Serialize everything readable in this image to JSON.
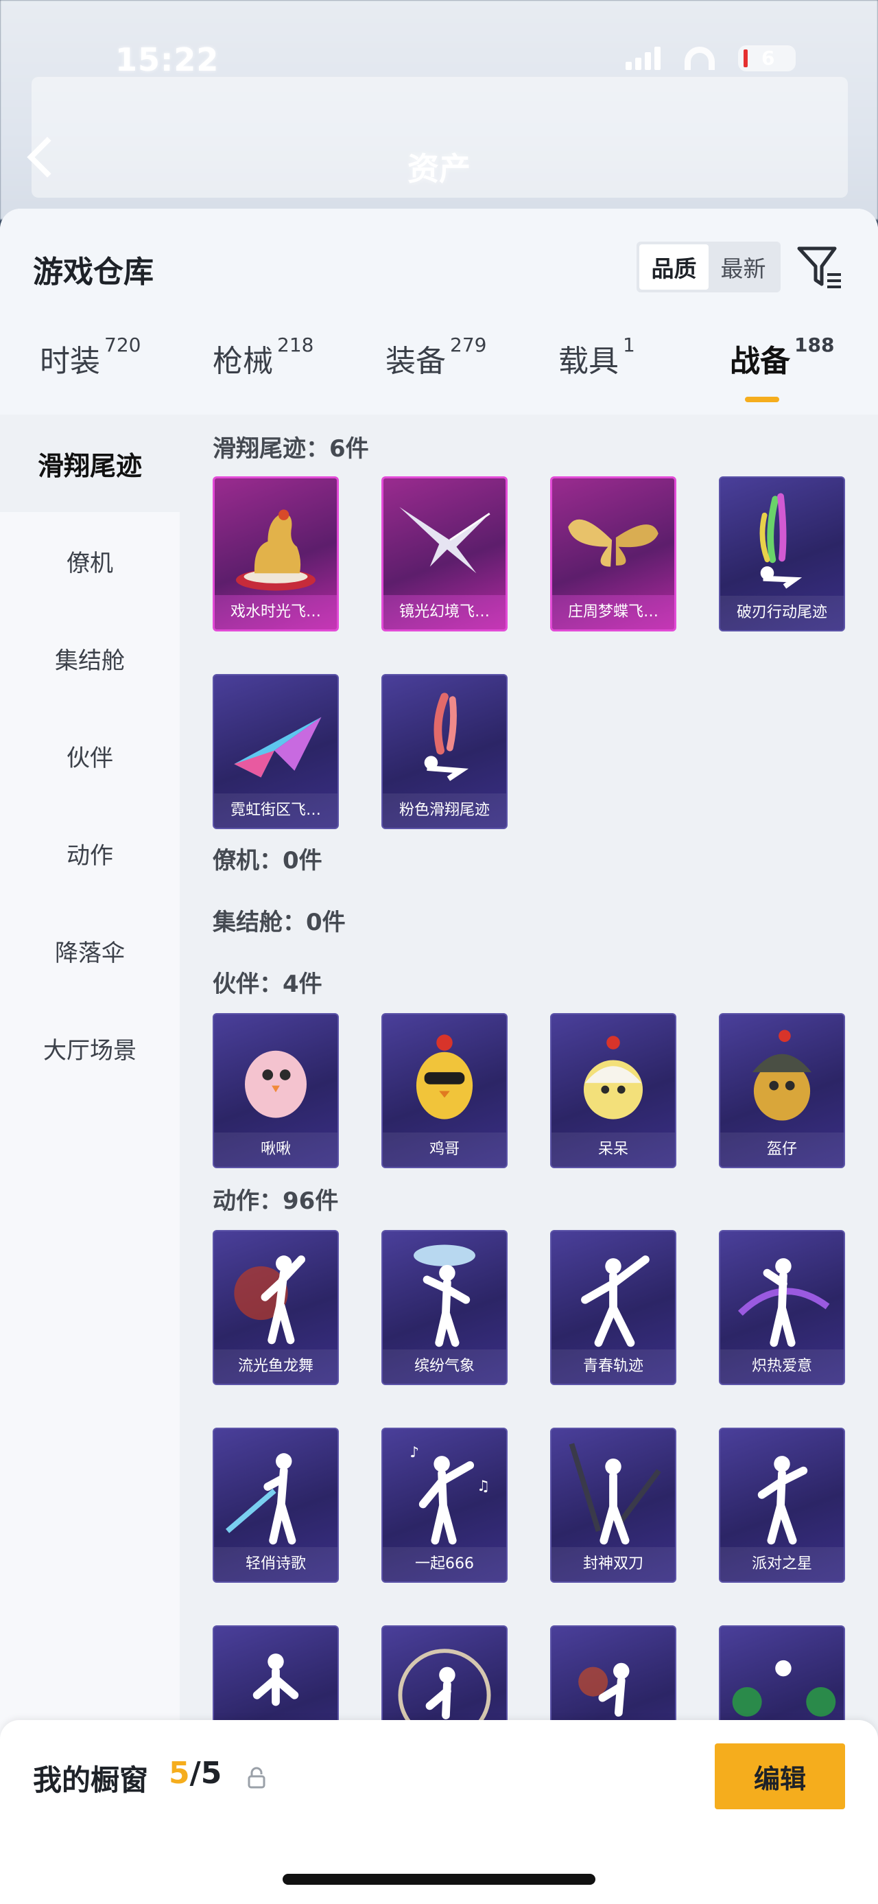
{
  "status_bar": {
    "time": "15:22",
    "battery": "6"
  },
  "nav": {
    "title": "资产"
  },
  "sheet": {
    "title": "游戏仓库",
    "sort": {
      "options": [
        "品质",
        "最新"
      ],
      "active": "品质"
    }
  },
  "tabs": [
    {
      "label": "时装",
      "count": "720"
    },
    {
      "label": "枪械",
      "count": "218"
    },
    {
      "label": "装备",
      "count": "279"
    },
    {
      "label": "载具",
      "count": "1"
    },
    {
      "label": "战备",
      "count": "188",
      "active": true
    }
  ],
  "side_nav": [
    "滑翔尾迹",
    "僚机",
    "集结舱",
    "伙伴",
    "动作",
    "降落伞",
    "大厅场景"
  ],
  "sections": {
    "glide": {
      "title": "滑翔尾迹：6件",
      "items": [
        "戏水时光飞…",
        "镜光幻境飞…",
        "庄周梦蝶飞…",
        "破刃行动尾迹",
        "霓虹街区飞…",
        "粉色滑翔尾迹"
      ]
    },
    "wingman": {
      "title": "僚机：0件"
    },
    "capsule": {
      "title": "集结舱：0件"
    },
    "partner": {
      "title": "伙伴：4件",
      "items": [
        "啾啾",
        "鸡哥",
        "呆呆",
        "盔仔"
      ]
    },
    "emote": {
      "title": "动作：96件",
      "items": [
        "流光鱼龙舞",
        "缤纷气象",
        "青春轨迹",
        "炽热爱意",
        "轻俏诗歌",
        "一起666",
        "封神双刀",
        "派对之星"
      ]
    }
  },
  "bottom_bar": {
    "title": "我的橱窗",
    "count_current": "5",
    "count_sep": "/",
    "count_total": "5",
    "edit_label": "编辑"
  },
  "colors": {
    "accent": "#f5ad1d",
    "card_purple": "#2c2566",
    "card_pink": "#b42aa0"
  }
}
